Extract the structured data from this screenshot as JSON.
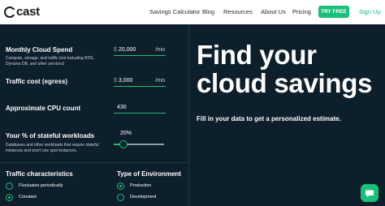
{
  "header": {
    "logo": "cast",
    "nav": [
      "Savings Calculator",
      "Blog",
      "Resources",
      "About Us",
      "Pricing"
    ],
    "try_button": "TRY FREE",
    "signup": "Sign Up"
  },
  "calculator": {
    "monthly_spend": {
      "label": "Monthly Cloud Spend",
      "description": "Compute, storage, and traffic (not including RDS, Dynamo DB, and other services)",
      "prefix": "$",
      "value": "20,000",
      "unit": "/mo"
    },
    "traffic_cost": {
      "label": "Traffic cost (egress)",
      "prefix": "$",
      "value": "3,000",
      "unit": "/mo"
    },
    "cpu_count": {
      "label": "Approximate CPU count",
      "value": "430"
    },
    "stateful": {
      "label": "Your % of stateful workloads",
      "description": "Databases and other workloads that require stateful instances and won't use spot instances.",
      "value_text": "20%",
      "percent": 20
    },
    "traffic_characteristics": {
      "label": "Traffic characteristics",
      "options": [
        "Fluctuates periodically",
        "Constant"
      ],
      "selected": "Constant"
    },
    "environment": {
      "label": "Type of Environment",
      "options": [
        "Production",
        "Development"
      ],
      "selected": "Production"
    }
  },
  "hero": {
    "headline_line1": "Find your",
    "headline_line2": "cloud savings",
    "subline": "Fill in your data to get a personalized estimate."
  },
  "colors": {
    "accent": "#19c07a",
    "background": "#0d1f2b"
  },
  "icons": {
    "chat": "chat-icon"
  }
}
